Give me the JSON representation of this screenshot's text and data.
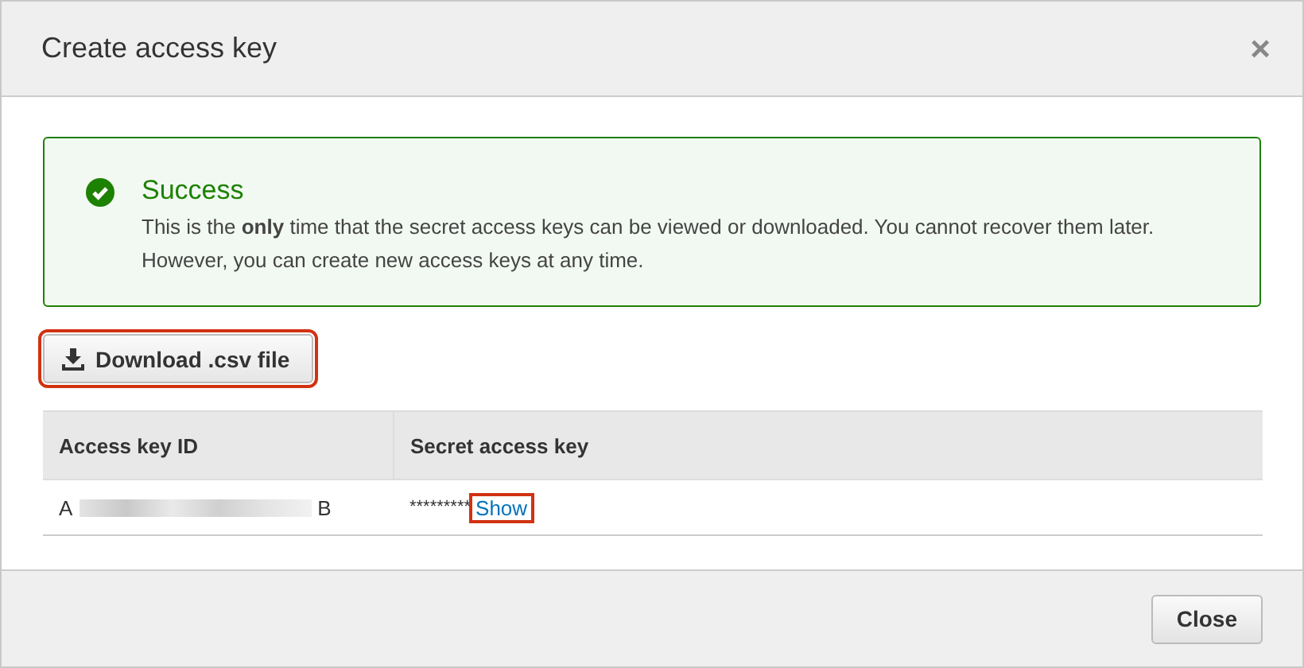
{
  "dialog": {
    "title": "Create access key",
    "close_glyph": "×"
  },
  "alert": {
    "title": "Success",
    "message": "This is the **only** time that the secret access keys can be viewed or downloaded. You cannot recover them later. However, you can create new access keys at any time."
  },
  "download_button": {
    "label": "Download .csv file",
    "highlighted": true
  },
  "table": {
    "columns": [
      "Access key ID",
      "Secret access key"
    ],
    "rows": [
      {
        "key_start": "A",
        "key_end": "B",
        "secret": "*********",
        "show_link": {
          "label": "Show",
          "highlighted": true
        }
      }
    ]
  },
  "footer": {
    "buttons": [
      "Close"
    ]
  }
}
